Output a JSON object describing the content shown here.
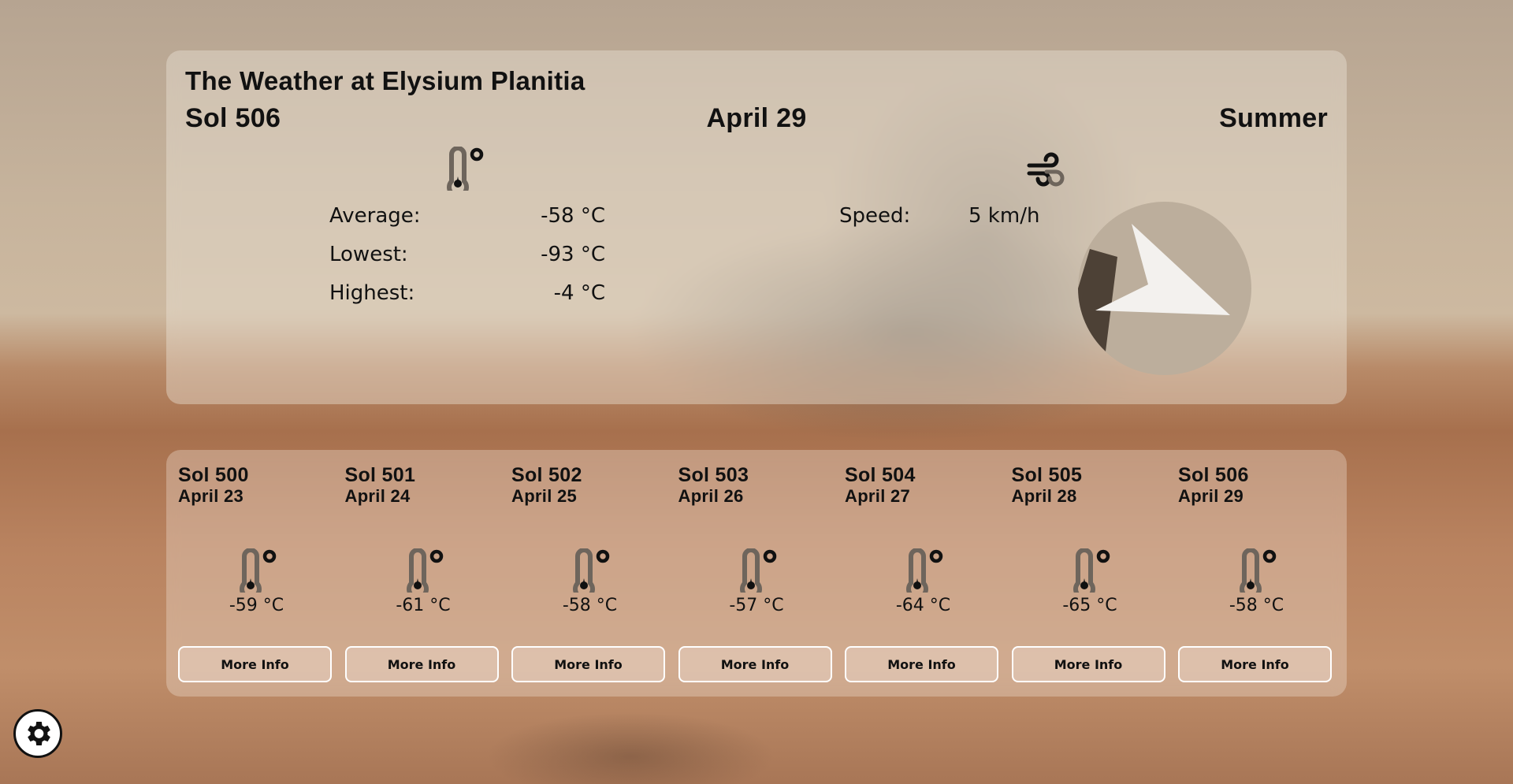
{
  "header": {
    "title": "The Weather at Elysium Planitia",
    "sol": "Sol 506",
    "date": "April 29",
    "season": "Summer"
  },
  "temperature": {
    "icon": "thermometer-icon",
    "rows": [
      {
        "label": "Average:",
        "value": "-58 °C"
      },
      {
        "label": "Lowest:",
        "value": "-93 °C"
      },
      {
        "label": "Highest:",
        "value": "-4 °C"
      }
    ]
  },
  "wind": {
    "icon": "wind-icon",
    "speed_label": "Speed:",
    "speed_value": "5 km/h",
    "direction_icon": "compass-arrow-icon"
  },
  "history": [
    {
      "sol": "Sol 500",
      "date": "April 23",
      "temp": "-59 °C",
      "button": "More Info"
    },
    {
      "sol": "Sol 501",
      "date": "April 24",
      "temp": "-61 °C",
      "button": "More Info"
    },
    {
      "sol": "Sol 502",
      "date": "April 25",
      "temp": "-58 °C",
      "button": "More Info"
    },
    {
      "sol": "Sol 503",
      "date": "April 26",
      "temp": "-57 °C",
      "button": "More Info"
    },
    {
      "sol": "Sol 504",
      "date": "April 27",
      "temp": "-64 °C",
      "button": "More Info"
    },
    {
      "sol": "Sol 505",
      "date": "April 28",
      "temp": "-65 °C",
      "button": "More Info"
    },
    {
      "sol": "Sol 506",
      "date": "April 29",
      "temp": "-58 °C",
      "button": "More Info"
    }
  ],
  "settings": {
    "icon": "gear-icon"
  }
}
